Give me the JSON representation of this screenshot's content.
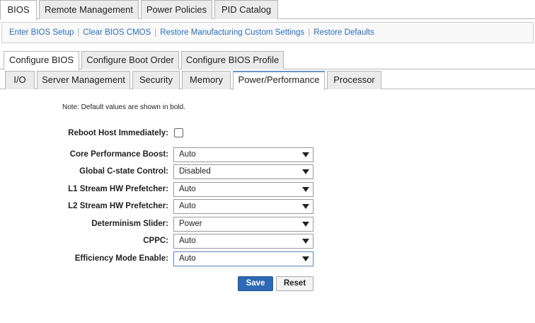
{
  "top_tabs": [
    {
      "label": "BIOS",
      "active": true
    },
    {
      "label": "Remote Management",
      "active": false
    },
    {
      "label": "Power Policies",
      "active": false
    },
    {
      "label": "PID Catalog",
      "active": false
    }
  ],
  "actions": [
    {
      "label": "Enter BIOS Setup"
    },
    {
      "label": "Clear BIOS CMOS"
    },
    {
      "label": "Restore Manufacturing Custom Settings"
    },
    {
      "label": "Restore Defaults"
    }
  ],
  "sub_tabs": [
    {
      "label": "Configure BIOS",
      "active": true
    },
    {
      "label": "Configure Boot Order",
      "active": false
    },
    {
      "label": "Configure BIOS Profile",
      "active": false
    }
  ],
  "section_tabs": [
    {
      "label": "I/O",
      "active": false
    },
    {
      "label": "Server Management",
      "active": false
    },
    {
      "label": "Security",
      "active": false
    },
    {
      "label": "Memory",
      "active": false
    },
    {
      "label": "Power/Performance",
      "active": true
    },
    {
      "label": "Processor",
      "active": false
    }
  ],
  "note": "Note: Default values are shown in bold.",
  "reboot": {
    "label": "Reboot Host Immediately:",
    "checked": false
  },
  "settings": [
    {
      "label": "Core Performance Boost:",
      "value": "Auto"
    },
    {
      "label": "Global C-state Control:",
      "value": "Disabled"
    },
    {
      "label": "L1 Stream HW Prefetcher:",
      "value": "Auto"
    },
    {
      "label": "L2 Stream HW Prefetcher:",
      "value": "Auto"
    },
    {
      "label": "Determinism Slider:",
      "value": "Power"
    },
    {
      "label": "CPPC:",
      "value": "Auto"
    },
    {
      "label": "Efficiency Mode Enable:",
      "value": "Auto"
    }
  ],
  "buttons": {
    "save": "Save",
    "reset": "Reset"
  },
  "colors": {
    "link": "#2a6ebb",
    "primary_button": "#2d6ab5",
    "active_tab_accent": "#6a93c8"
  }
}
